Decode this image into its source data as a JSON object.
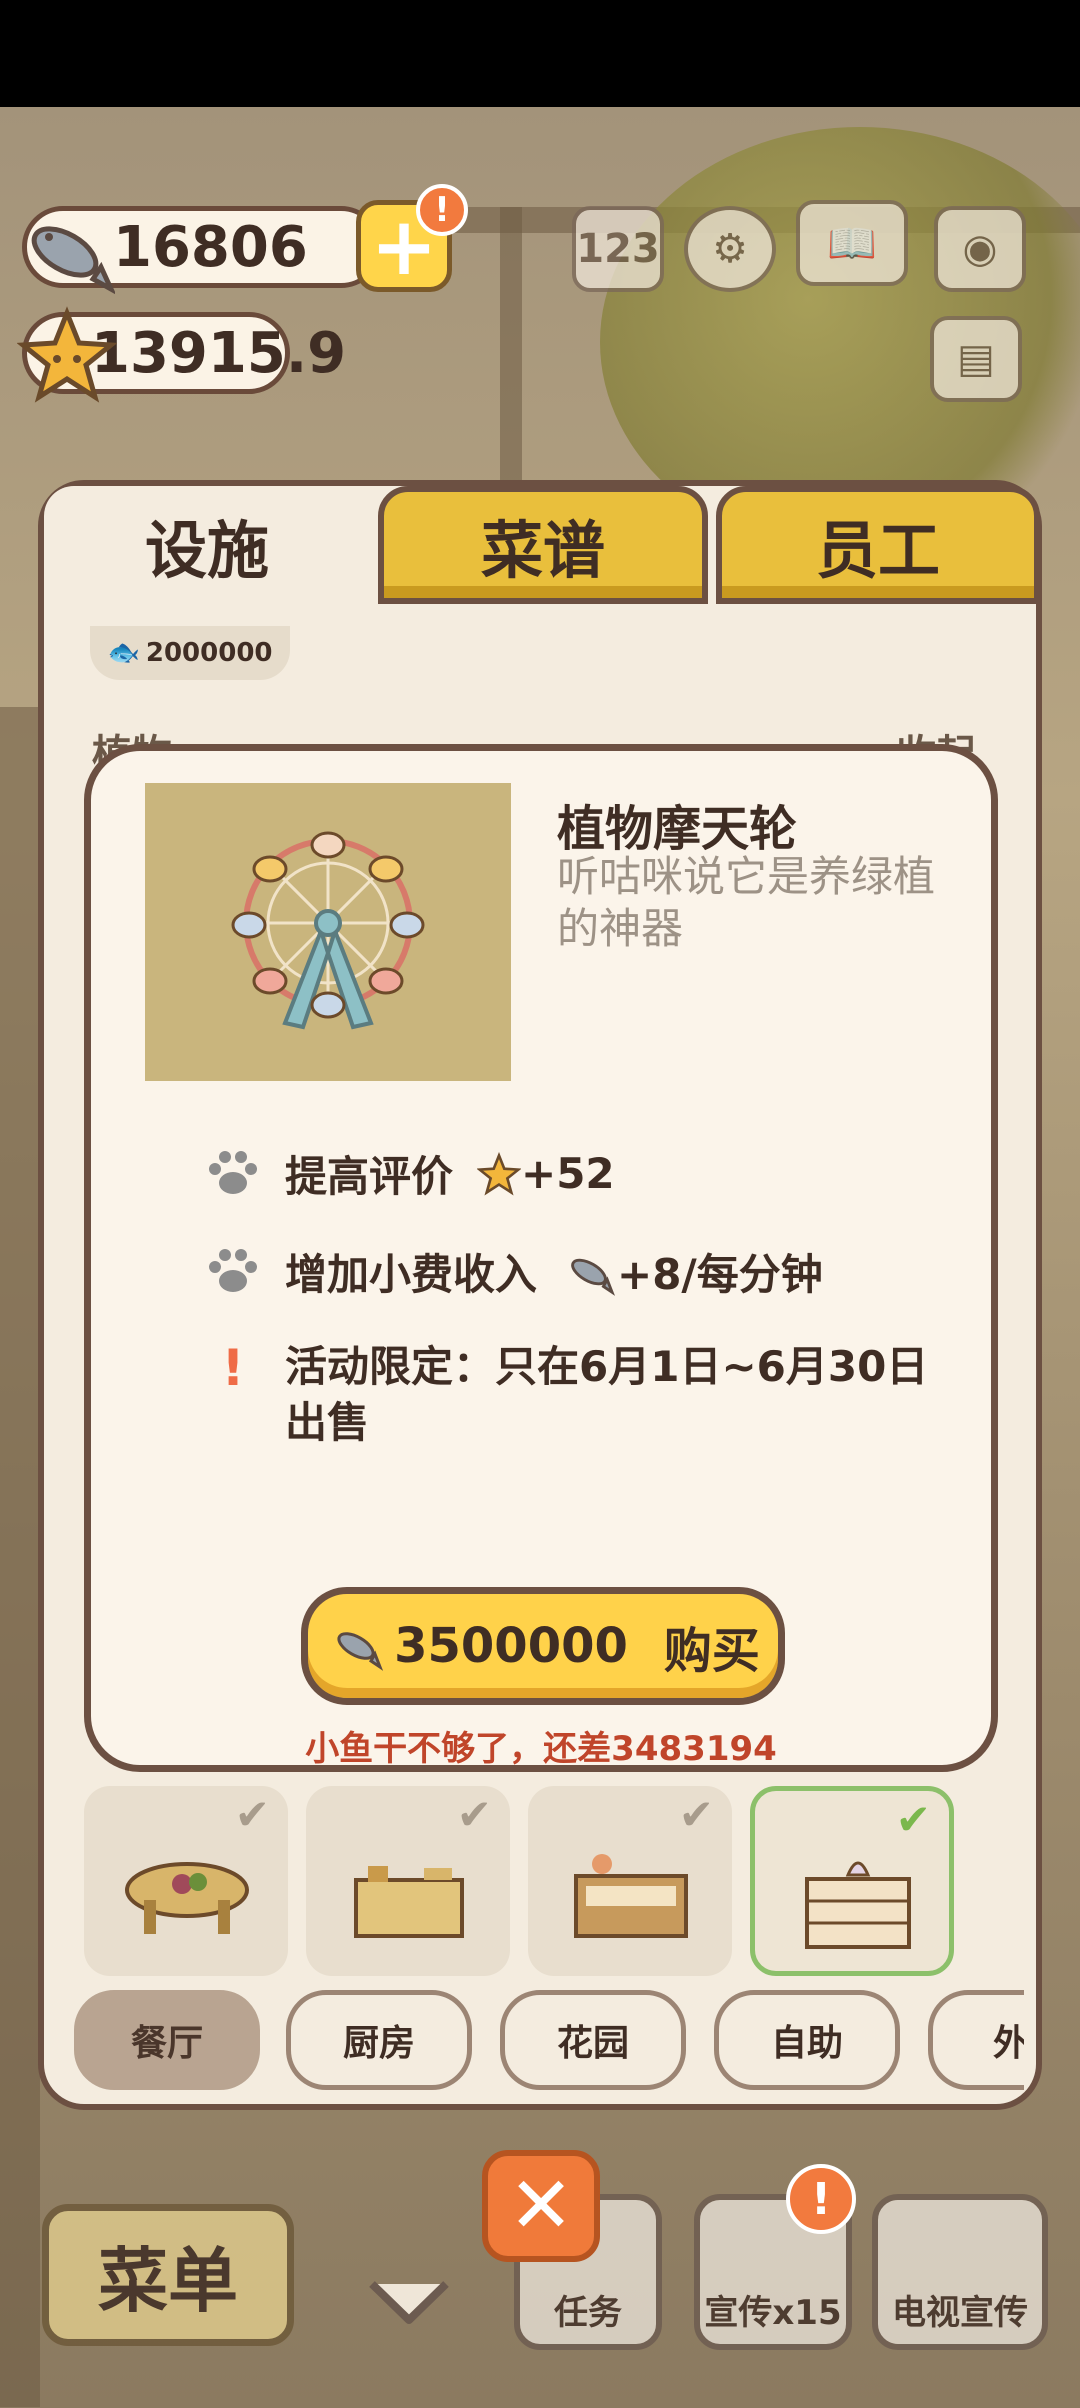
{
  "hud": {
    "fish_amount": "16806",
    "star_amount": "13915.9",
    "alert_mark": "!"
  },
  "tabs": [
    {
      "label": "设施"
    },
    {
      "label": "菜谱"
    },
    {
      "label": "员工"
    }
  ],
  "peek_card": {
    "price": "2000000"
  },
  "section": {
    "label": "植物",
    "collapse": "收起"
  },
  "popup": {
    "title": "植物摩天轮",
    "description": "听咕咪说它是养绿植的神器",
    "stats": [
      {
        "label": "提高评价",
        "value": "+52",
        "icon": "star-icon"
      },
      {
        "label": "增加小费收入",
        "value": "+8/每分钟",
        "icon": "fish-icon"
      }
    ],
    "limit_mark": "!",
    "limit_text": "活动限定：只在6月1日~6月30日出售",
    "buy": {
      "price": "3500000",
      "label": "购买"
    },
    "shortage": "小鱼干不够了，还差3483194"
  },
  "categories": [
    "餐厅",
    "厨房",
    "花园",
    "自助",
    "外"
  ],
  "bottom": {
    "menu": "菜单",
    "close": "✕",
    "task": "任务",
    "promo": "宣传x15",
    "tv": "电视宣传",
    "alert": "!"
  },
  "colors": {
    "accent_yellow": "#ffd24a",
    "panel_bg": "#f4ecdf",
    "border_brown": "#6c5042",
    "warning_red": "#c0452a",
    "check_green": "#7bb84d"
  }
}
